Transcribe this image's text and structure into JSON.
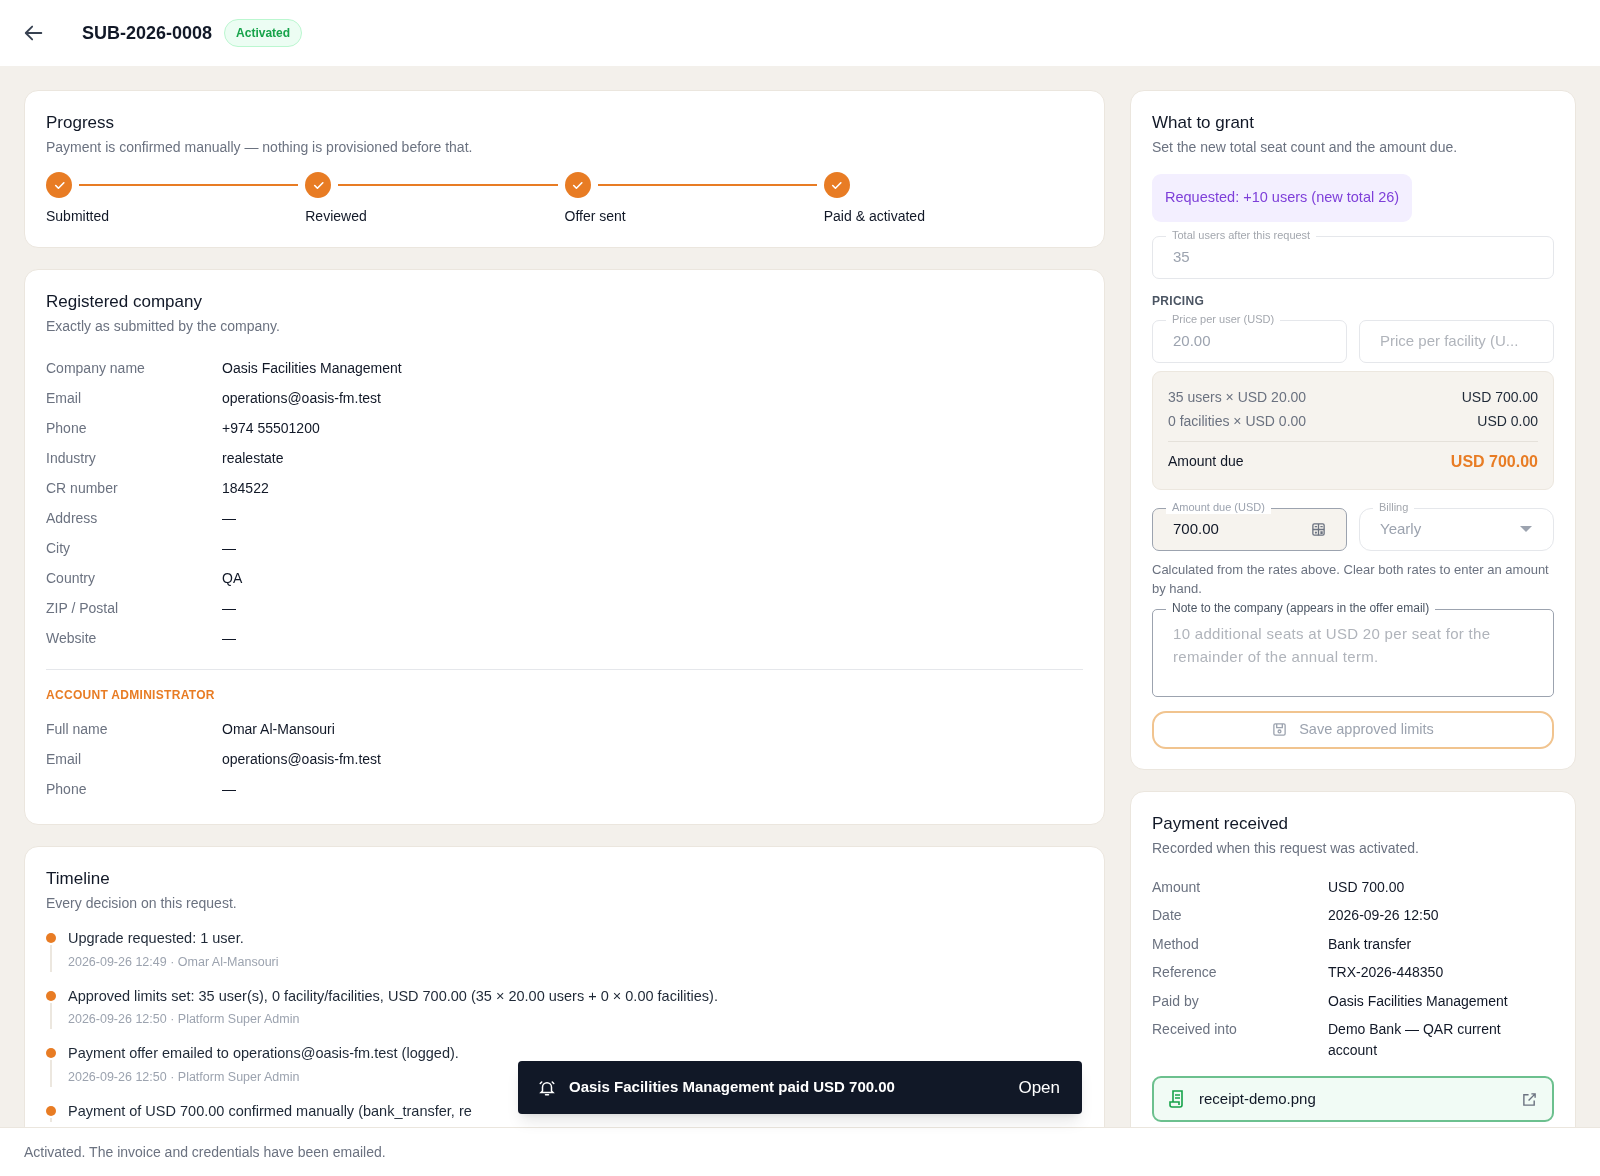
{
  "header": {
    "title": "SUB-2026-0008",
    "status": "Activated"
  },
  "progress": {
    "title": "Progress",
    "subtitle": "Payment is confirmed manually — nothing is provisioned before that.",
    "steps": [
      {
        "label": "Submitted",
        "done": true
      },
      {
        "label": "Reviewed",
        "done": true
      },
      {
        "label": "Offer sent",
        "done": true
      },
      {
        "label": "Paid & activated",
        "done": true
      }
    ]
  },
  "company": {
    "title": "Registered company",
    "subtitle": "Exactly as submitted by the company.",
    "fields": [
      {
        "label": "Company name",
        "value": "Oasis Facilities Management"
      },
      {
        "label": "Email",
        "value": "operations@oasis-fm.test"
      },
      {
        "label": "Phone",
        "value": "+974 55501200"
      },
      {
        "label": "Industry",
        "value": "realestate"
      },
      {
        "label": "CR number",
        "value": "184522"
      },
      {
        "label": "Address",
        "value": "—"
      },
      {
        "label": "City",
        "value": "—"
      },
      {
        "label": "Country",
        "value": "QA"
      },
      {
        "label": "ZIP / Postal",
        "value": "—"
      },
      {
        "label": "Website",
        "value": "—"
      }
    ],
    "admin_heading": "ACCOUNT ADMINISTRATOR",
    "admin_fields": [
      {
        "label": "Full name",
        "value": "Omar Al-Mansouri"
      },
      {
        "label": "Email",
        "value": "operations@oasis-fm.test"
      },
      {
        "label": "Phone",
        "value": "—"
      }
    ]
  },
  "timeline": {
    "title": "Timeline",
    "subtitle": "Every decision on this request.",
    "events": [
      {
        "text": "Upgrade requested: 1 user.",
        "meta": "2026-09-26 12:49 · Omar Al-Mansouri"
      },
      {
        "text": "Approved limits set: 35 user(s), 0 facility/facilities, USD 700.00 (35 × 20.00 users + 0 × 0.00 facilities).",
        "meta": "2026-09-26 12:50 · Platform Super Admin"
      },
      {
        "text": "Payment offer emailed to operations@oasis-fm.test (logged).",
        "meta": "2026-09-26 12:50 · Platform Super Admin"
      },
      {
        "text": "Payment of USD 700.00 confirmed manually (bank_transfer, re"
      }
    ]
  },
  "grant": {
    "title": "What to grant",
    "subtitle": "Set the new total seat count and the amount due.",
    "request_note": "Requested: +10 users (new total 26)",
    "total_users": {
      "label": "Total users after this request",
      "value": "35",
      "disabled": true
    },
    "pricing_heading": "PRICING",
    "price_per_user": {
      "label": "Price per user (USD)",
      "value": "20.00",
      "disabled": true
    },
    "price_per_facility": {
      "placeholder": "Price per facility (U...",
      "disabled": true
    },
    "breakdown": [
      {
        "text": "35 users × USD 20.00",
        "amount": "USD 700.00"
      },
      {
        "text": "0 facilities × USD 0.00",
        "amount": "USD 0.00"
      }
    ],
    "total_label": "Amount due",
    "total_value": "USD 700.00",
    "amount_field": {
      "label": "Amount due (USD)",
      "value": "700.00",
      "disabled": false
    },
    "billing": {
      "label": "Billing",
      "value": "Yearly",
      "disabled": true
    },
    "hint": "Calculated from the rates above. Clear both rates to enter an amount by hand.",
    "note": {
      "label": "Note to the company (appears in the offer email)",
      "placeholder": "10 additional seats at USD 20 per seat for the remainder of the annual term."
    },
    "save_button": {
      "label": "Save approved limits",
      "disabled": true
    }
  },
  "payment": {
    "title": "Payment received",
    "subtitle": "Recorded when this request was activated.",
    "fields": [
      {
        "label": "Amount",
        "value": "USD 700.00"
      },
      {
        "label": "Date",
        "value": "2026-09-26 12:50"
      },
      {
        "label": "Method",
        "value": "Bank transfer"
      },
      {
        "label": "Reference",
        "value": "TRX-2026-448350"
      },
      {
        "label": "Paid by",
        "value": "Oasis Facilities Management"
      },
      {
        "label": "Received into",
        "value": "Demo Bank — QAR current account"
      }
    ],
    "receipt": "receipt-demo.png"
  },
  "toast": {
    "message": "Oasis Facilities Management paid USD 700.00",
    "action": "Open"
  },
  "status_bar": "Activated. The invoice and credentials have been emailed."
}
